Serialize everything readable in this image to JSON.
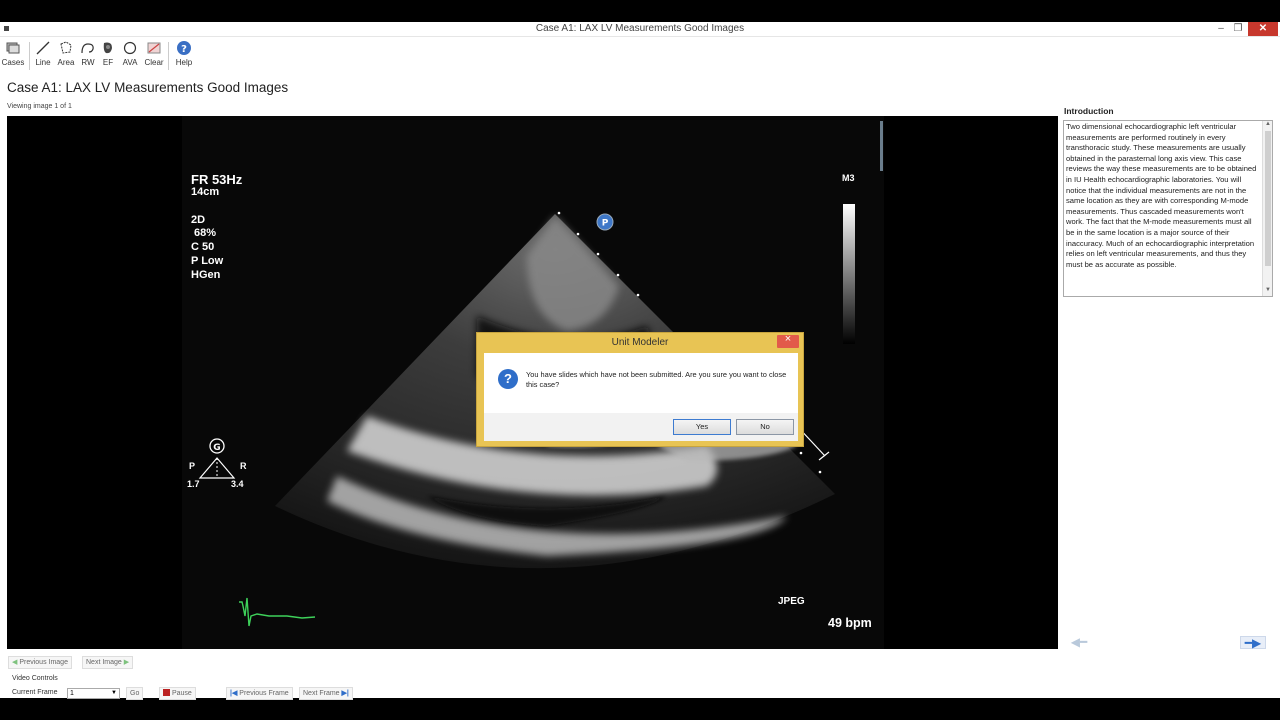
{
  "window": {
    "title": "Case A1: LAX LV Measurements Good Images",
    "close_glyph": "✕",
    "minimize_glyph": "–",
    "restore_glyph": "❐"
  },
  "toolbar": {
    "items": [
      {
        "label": "Cases",
        "icon": "cases-icon"
      },
      {
        "label": "Line",
        "icon": "line-icon"
      },
      {
        "label": "Area",
        "icon": "area-icon"
      },
      {
        "label": "RW",
        "icon": "rw-icon"
      },
      {
        "label": "EF",
        "icon": "ef-icon"
      },
      {
        "label": "AVA",
        "icon": "ava-icon"
      },
      {
        "label": "Clear",
        "icon": "clear-icon"
      },
      {
        "label": "Help",
        "icon": "help-icon"
      }
    ]
  },
  "main": {
    "case_title": "Case A1: LAX LV Measurements Good Images",
    "viewing": "Viewing image 1 of 1"
  },
  "image_overlay": {
    "fr": "FR 53Hz",
    "depth": "14cm",
    "mode": "2D",
    "gain": " 68%",
    "c": "C 50",
    "p": "P Low",
    "hgen": "HGen",
    "m3": "M3",
    "p_marker": "P",
    "g_marker": "G",
    "p_label": "P",
    "r_label": "R",
    "left_val": "1.7",
    "right_val": "3.4",
    "format": "JPEG",
    "bpm": "49 bpm"
  },
  "intro": {
    "title": "Introduction",
    "text": "Two dimensional echocardiographic left ventricular measurements are performed routinely in every transthoracic study. These measurements are usually obtained in the parasternal long axis view. This case reviews the way these measurements are to be obtained in IU Health echocardiographic laboratories. You will notice that the individual measurements are not in the same location as they are with corresponding M-mode measurements. Thus cascaded measurements won't work. The fact that the M-mode measurements must all be in the same location is a major source of their inaccuracy. Much of an echocardiographic interpretation relies on left ventricular measurements, and thus they must be as accurate as possible."
  },
  "nav": {
    "previous_image": "Previous Image",
    "next_image": "Next Image",
    "video_controls": "Video Controls",
    "current_frame_label": "Current Frame",
    "current_frame_value": "1",
    "go": "Go",
    "pause": "Pause",
    "previous_frame": "Previous Frame",
    "next_frame": "Next Frame"
  },
  "dialog": {
    "title": "Unit Modeler",
    "message": "You have slides which have not been submitted.  Are you sure you want to close this case?",
    "yes": "Yes",
    "no": "No"
  },
  "colors": {
    "accent": "#2f6ec9",
    "dialog_frame": "#e8c454",
    "close_red": "#c7382d"
  }
}
